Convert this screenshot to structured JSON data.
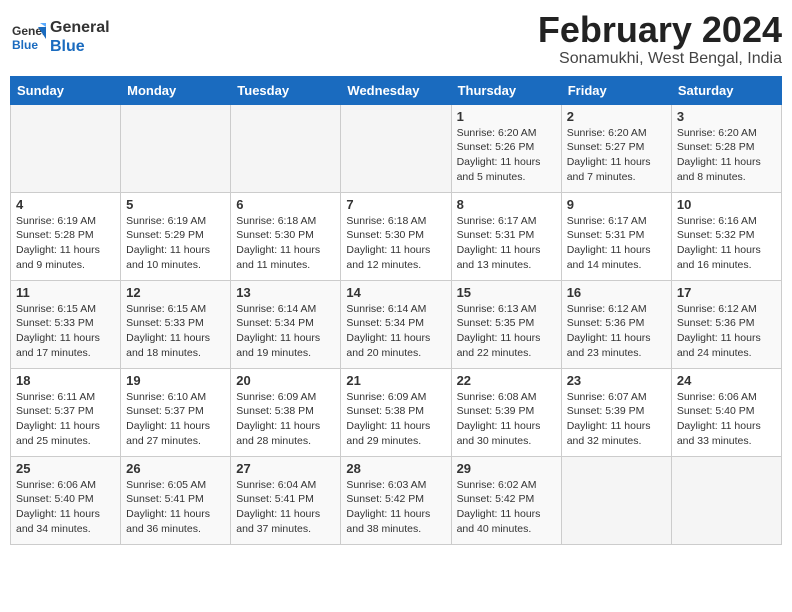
{
  "header": {
    "logo_line1": "General",
    "logo_line2": "Blue",
    "month_title": "February 2024",
    "location": "Sonamukhi, West Bengal, India"
  },
  "weekdays": [
    "Sunday",
    "Monday",
    "Tuesday",
    "Wednesday",
    "Thursday",
    "Friday",
    "Saturday"
  ],
  "weeks": [
    [
      {
        "day": "",
        "info": ""
      },
      {
        "day": "",
        "info": ""
      },
      {
        "day": "",
        "info": ""
      },
      {
        "day": "",
        "info": ""
      },
      {
        "day": "1",
        "info": "Sunrise: 6:20 AM\nSunset: 5:26 PM\nDaylight: 11 hours\nand 5 minutes."
      },
      {
        "day": "2",
        "info": "Sunrise: 6:20 AM\nSunset: 5:27 PM\nDaylight: 11 hours\nand 7 minutes."
      },
      {
        "day": "3",
        "info": "Sunrise: 6:20 AM\nSunset: 5:28 PM\nDaylight: 11 hours\nand 8 minutes."
      }
    ],
    [
      {
        "day": "4",
        "info": "Sunrise: 6:19 AM\nSunset: 5:28 PM\nDaylight: 11 hours\nand 9 minutes."
      },
      {
        "day": "5",
        "info": "Sunrise: 6:19 AM\nSunset: 5:29 PM\nDaylight: 11 hours\nand 10 minutes."
      },
      {
        "day": "6",
        "info": "Sunrise: 6:18 AM\nSunset: 5:30 PM\nDaylight: 11 hours\nand 11 minutes."
      },
      {
        "day": "7",
        "info": "Sunrise: 6:18 AM\nSunset: 5:30 PM\nDaylight: 11 hours\nand 12 minutes."
      },
      {
        "day": "8",
        "info": "Sunrise: 6:17 AM\nSunset: 5:31 PM\nDaylight: 11 hours\nand 13 minutes."
      },
      {
        "day": "9",
        "info": "Sunrise: 6:17 AM\nSunset: 5:31 PM\nDaylight: 11 hours\nand 14 minutes."
      },
      {
        "day": "10",
        "info": "Sunrise: 6:16 AM\nSunset: 5:32 PM\nDaylight: 11 hours\nand 16 minutes."
      }
    ],
    [
      {
        "day": "11",
        "info": "Sunrise: 6:15 AM\nSunset: 5:33 PM\nDaylight: 11 hours\nand 17 minutes."
      },
      {
        "day": "12",
        "info": "Sunrise: 6:15 AM\nSunset: 5:33 PM\nDaylight: 11 hours\nand 18 minutes."
      },
      {
        "day": "13",
        "info": "Sunrise: 6:14 AM\nSunset: 5:34 PM\nDaylight: 11 hours\nand 19 minutes."
      },
      {
        "day": "14",
        "info": "Sunrise: 6:14 AM\nSunset: 5:34 PM\nDaylight: 11 hours\nand 20 minutes."
      },
      {
        "day": "15",
        "info": "Sunrise: 6:13 AM\nSunset: 5:35 PM\nDaylight: 11 hours\nand 22 minutes."
      },
      {
        "day": "16",
        "info": "Sunrise: 6:12 AM\nSunset: 5:36 PM\nDaylight: 11 hours\nand 23 minutes."
      },
      {
        "day": "17",
        "info": "Sunrise: 6:12 AM\nSunset: 5:36 PM\nDaylight: 11 hours\nand 24 minutes."
      }
    ],
    [
      {
        "day": "18",
        "info": "Sunrise: 6:11 AM\nSunset: 5:37 PM\nDaylight: 11 hours\nand 25 minutes."
      },
      {
        "day": "19",
        "info": "Sunrise: 6:10 AM\nSunset: 5:37 PM\nDaylight: 11 hours\nand 27 minutes."
      },
      {
        "day": "20",
        "info": "Sunrise: 6:09 AM\nSunset: 5:38 PM\nDaylight: 11 hours\nand 28 minutes."
      },
      {
        "day": "21",
        "info": "Sunrise: 6:09 AM\nSunset: 5:38 PM\nDaylight: 11 hours\nand 29 minutes."
      },
      {
        "day": "22",
        "info": "Sunrise: 6:08 AM\nSunset: 5:39 PM\nDaylight: 11 hours\nand 30 minutes."
      },
      {
        "day": "23",
        "info": "Sunrise: 6:07 AM\nSunset: 5:39 PM\nDaylight: 11 hours\nand 32 minutes."
      },
      {
        "day": "24",
        "info": "Sunrise: 6:06 AM\nSunset: 5:40 PM\nDaylight: 11 hours\nand 33 minutes."
      }
    ],
    [
      {
        "day": "25",
        "info": "Sunrise: 6:06 AM\nSunset: 5:40 PM\nDaylight: 11 hours\nand 34 minutes."
      },
      {
        "day": "26",
        "info": "Sunrise: 6:05 AM\nSunset: 5:41 PM\nDaylight: 11 hours\nand 36 minutes."
      },
      {
        "day": "27",
        "info": "Sunrise: 6:04 AM\nSunset: 5:41 PM\nDaylight: 11 hours\nand 37 minutes."
      },
      {
        "day": "28",
        "info": "Sunrise: 6:03 AM\nSunset: 5:42 PM\nDaylight: 11 hours\nand 38 minutes."
      },
      {
        "day": "29",
        "info": "Sunrise: 6:02 AM\nSunset: 5:42 PM\nDaylight: 11 hours\nand 40 minutes."
      },
      {
        "day": "",
        "info": ""
      },
      {
        "day": "",
        "info": ""
      }
    ]
  ]
}
